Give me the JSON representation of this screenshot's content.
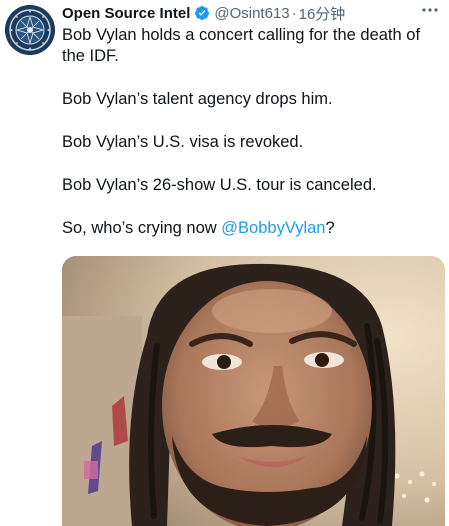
{
  "tweet": {
    "author_name": "Open Source Intel",
    "handle": "@Osint613",
    "separator": "·",
    "time": "16分钟",
    "lines": [
      "Bob Vylan holds a concert calling for the death of the IDF.",
      "Bob Vylan’s talent agency drops him.",
      "Bob Vylan’s U.S. visa is revoked.",
      "Bob Vylan’s 26-show U.S. tour is canceled."
    ],
    "final_line_prefix": "So, who’s crying now ",
    "mention": "@BobbyVylan",
    "final_line_suffix": "?"
  },
  "icons": {
    "verified": "verified-badge-icon",
    "more": "more-options-icon",
    "avatar": "seal-logo"
  },
  "colors": {
    "link": "#1d9bf0",
    "secondary_text": "#536471",
    "verified": "#1d9bf0"
  }
}
